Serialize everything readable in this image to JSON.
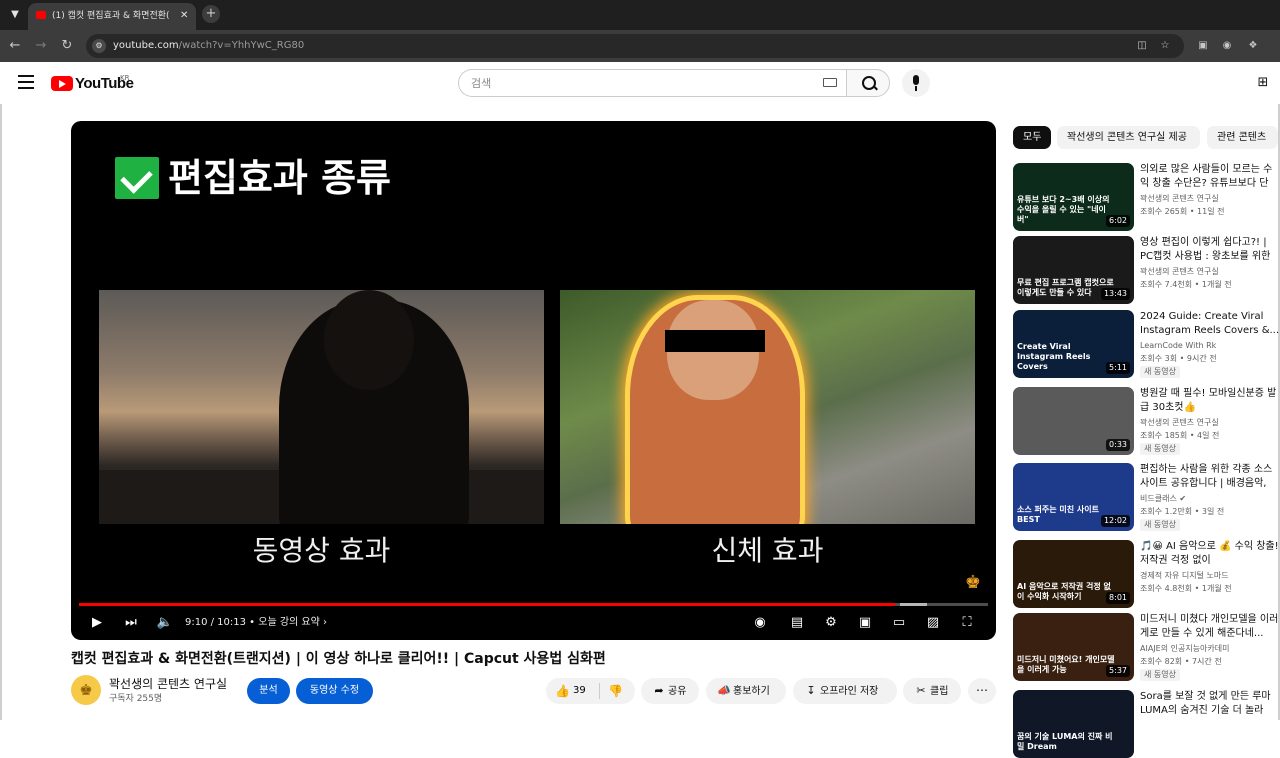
{
  "browser": {
    "tab_title": "(1) 캡컷 편집효과 & 화면전환(",
    "url_host": "youtube.com",
    "url_path": "/watch?v=YhhYwC_RG80"
  },
  "header": {
    "logo": "YouTube",
    "region": "KR",
    "search_placeholder": "검색"
  },
  "video": {
    "slide_title": "편집효과 종류",
    "caption_left": "동영상 효과",
    "caption_right": "신체 효과",
    "time": "9:10 / 10:13 • 오늘 강의 요약 ›",
    "progress_fraction": 0.8973,
    "title": "캡컷 편집효과 & 화면전환(트랜지션) | 이 영상 하나로 클리어!! | Capcut 사용법 심화편"
  },
  "channel": {
    "name": "꽉선생의 콘텐츠 연구실",
    "subscribers": "구독자 255명",
    "btn_analytics": "분석",
    "btn_edit": "동영상 수정"
  },
  "actions": {
    "like_count": "39",
    "share": "공유",
    "promote": "홍보하기",
    "offline": "오프라인 저장",
    "clip": "클립"
  },
  "chips": [
    "모두",
    "꽉선생의 콘텐츠 연구실 제공",
    "관련 콘텐츠"
  ],
  "recommendations": [
    {
      "title": "의외로 많은 사람들이 모르는 수익 창출 수단은? 유튜브보다 단",
      "channel": "꽉선생의 콘텐츠 연구실",
      "meta": "조회수 265회 • 11일 전",
      "badge": "",
      "duration": "6:02",
      "thumb_text": "유튜브 보다 2~3배 이상의 수익을 올릴 수 있는 \"네이버\"",
      "thumb_color": "#0d2b1a"
    },
    {
      "title": "영상 편집이 이렇게 쉽다고?! | PC캡컷 사용법 : 왕초보를 위한",
      "channel": "꽉선생의 콘텐츠 연구실",
      "meta": "조회수 7.4천회 • 1개월 전",
      "badge": "",
      "duration": "13:43",
      "thumb_text": "무료 편집 프로그램 캡컷으로 이렇게도 만들 수 있다",
      "thumb_color": "#1a1a1a"
    },
    {
      "title": "2024 Guide: Create Viral Instagram Reels Covers &...",
      "channel": "LearnCode With Rk",
      "meta": "조회수 3회 • 9시간 전",
      "badge": "새 동영상",
      "duration": "5:11",
      "thumb_text": "Create Viral Instagram Reels Covers",
      "thumb_color": "#0b1f3a"
    },
    {
      "title": "병원갈 때 필수! 모바일신분증 발급 30초컷👍",
      "channel": "꽉선생의 콘텐츠 연구실",
      "meta": "조회수 185회 • 4일 전",
      "badge": "새 동영상",
      "duration": "0:33",
      "thumb_text": "",
      "thumb_color": "#5a5a5a"
    },
    {
      "title": "편집하는 사람을 위한 각종 소스 사이트 공유합니다 | 배경음악,",
      "channel": "비드클래스 ✔",
      "meta": "조회수 1.2만회 • 3일 전",
      "badge": "새 동영상",
      "duration": "12:02",
      "thumb_text": "소스 퍼주는 미친 사이트 BEST",
      "thumb_color": "#1e3a8a"
    },
    {
      "title": "🎵😀 AI 음악으로 💰 수익 창출! 저작권 걱정 없이",
      "channel": "경제적 자유 디지털 노마드",
      "meta": "조회수 4.8천회 • 1개월 전",
      "badge": "",
      "duration": "8:01",
      "thumb_text": "AI 음악으로 저작권 걱정 없이 수익화 시작하기",
      "thumb_color": "#2a1a0a"
    },
    {
      "title": "미드저니 미쳤다 개인모델을 이러게로 만들 수 있게 해준다네...",
      "channel": "AIAJE의 인공지능아카데미",
      "meta": "조회수 82회 • 7시간 전",
      "badge": "새 동영상",
      "duration": "5:37",
      "thumb_text": "미드저니 미쳤어요! 개인모델을 이러게 가능",
      "thumb_color": "#3a2010"
    },
    {
      "title": "Sora를 보잘 것 없게 만든 루마 LUMA의 숨겨진 기술 더 놀라",
      "channel": "",
      "meta": "",
      "badge": "",
      "duration": "",
      "thumb_text": "꿈의 기술 LUMA의 진짜 비밀 Dream",
      "thumb_color": "#101828"
    }
  ]
}
